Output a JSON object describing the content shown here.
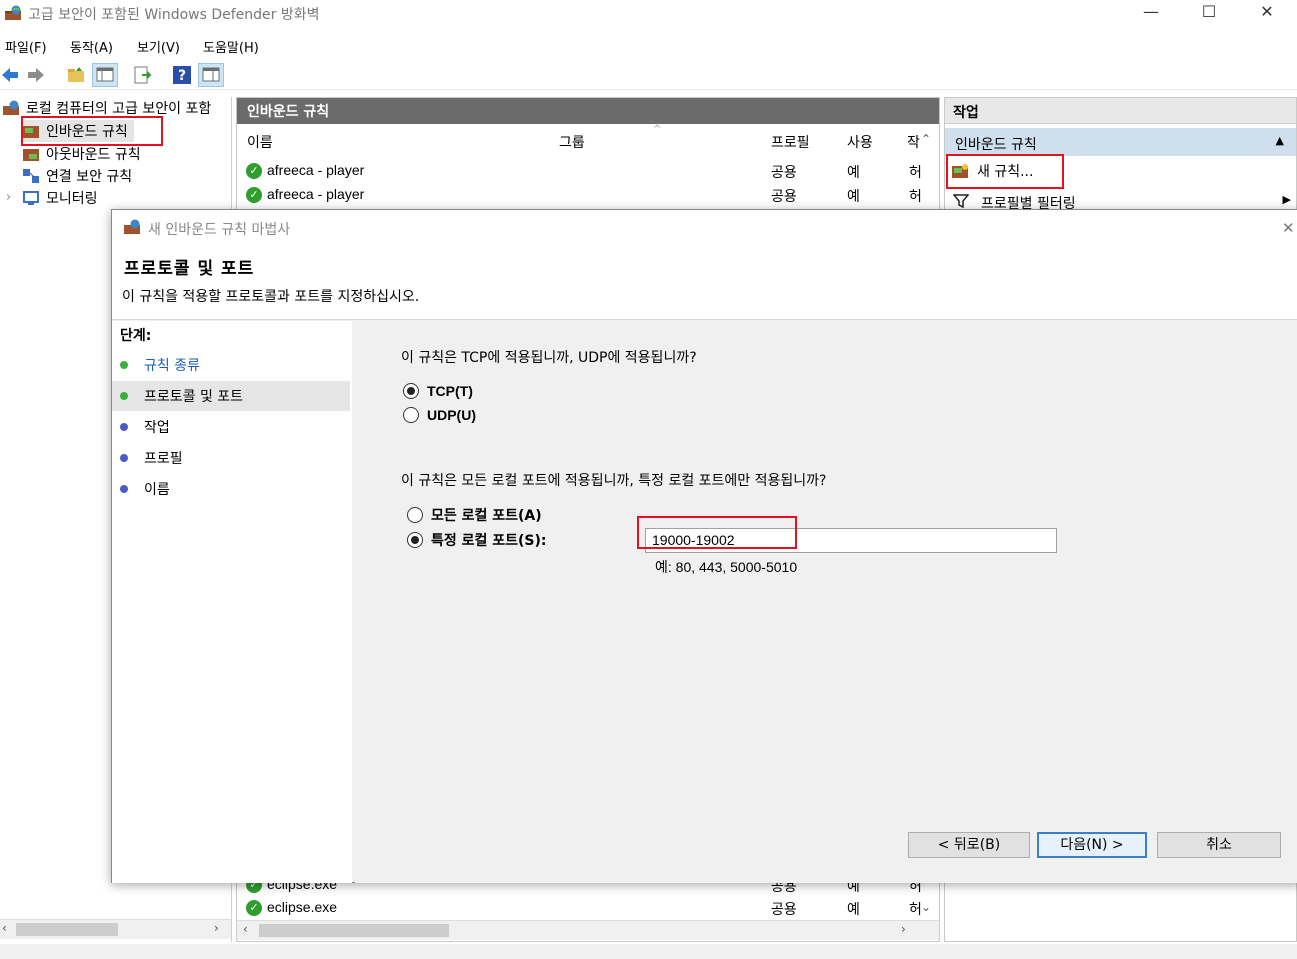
{
  "window": {
    "title": "고급 보안이 포함된 Windows Defender 방화벽",
    "minimize": "—",
    "maximize": "☐",
    "close": "✕"
  },
  "menu": [
    "파일(F)",
    "동작(A)",
    "보기(V)",
    "도움말(H)"
  ],
  "tree": {
    "root": "로컬 컴퓨터의 고급 보안이 포함",
    "items": [
      "인바운드 규칙",
      "아웃바운드 규칙",
      "연결 보안 규칙",
      "모니터링"
    ],
    "expander": "›"
  },
  "center": {
    "header": "인바운드 규칙",
    "columns": [
      "이름",
      "그룹",
      "프로필",
      "사용",
      "작"
    ],
    "rows_top": [
      {
        "name": "afreeca - player",
        "profile": "공용",
        "enabled": "예",
        "action": "허"
      },
      {
        "name": "afreeca - player",
        "profile": "공용",
        "enabled": "예",
        "action": "허"
      }
    ],
    "rows_bottom": [
      {
        "name": "eclipse.exe",
        "profile": "공용",
        "enabled": "예",
        "action": "허"
      },
      {
        "name": "eclipse.exe",
        "profile": "공용",
        "enabled": "예",
        "action": "허"
      }
    ]
  },
  "actions": {
    "title": "작업",
    "section": "인바운드 규칙",
    "items": [
      "새 규칙...",
      "프로필별 필터링"
    ]
  },
  "wizard": {
    "title": "새 인바운드 규칙 마법사",
    "heading": "프로토콜 및 포트",
    "description": "이 규칙을 적용할 프로토콜과 포트를 지정하십시오.",
    "steps_label": "단계:",
    "steps": [
      {
        "label": "규칙 종류",
        "color": "#3cae3c",
        "link": true
      },
      {
        "label": "프로토콜 및 포트",
        "color": "#3cae3c",
        "link": false
      },
      {
        "label": "작업",
        "color": "#4a5bc6",
        "link": false
      },
      {
        "label": "프로필",
        "color": "#4a5bc6",
        "link": false
      },
      {
        "label": "이름",
        "color": "#4a5bc6",
        "link": false
      }
    ],
    "q_protocol": "이 규칙은 TCP에 적용됩니까, UDP에 적용됩니까?",
    "protocol_options": [
      {
        "label": "TCP(T)",
        "selected": true
      },
      {
        "label": "UDP(U)",
        "selected": false
      }
    ],
    "q_ports": "이 규칙은 모든 로컬 포트에 적용됩니까, 특정 로컬 포트에만 적용됩니까?",
    "port_options": [
      {
        "label": "모든 로컬 포트(A)",
        "selected": false
      },
      {
        "label": "특정 로컬 포트(S):",
        "selected": true
      }
    ],
    "port_value": "19000-19002",
    "example": "예: 80, 443, 5000-5010",
    "buttons": {
      "back": "< 뒤로(B)",
      "next": "다음(N) >",
      "cancel": "취소"
    }
  },
  "accent_red": "#e0141e"
}
